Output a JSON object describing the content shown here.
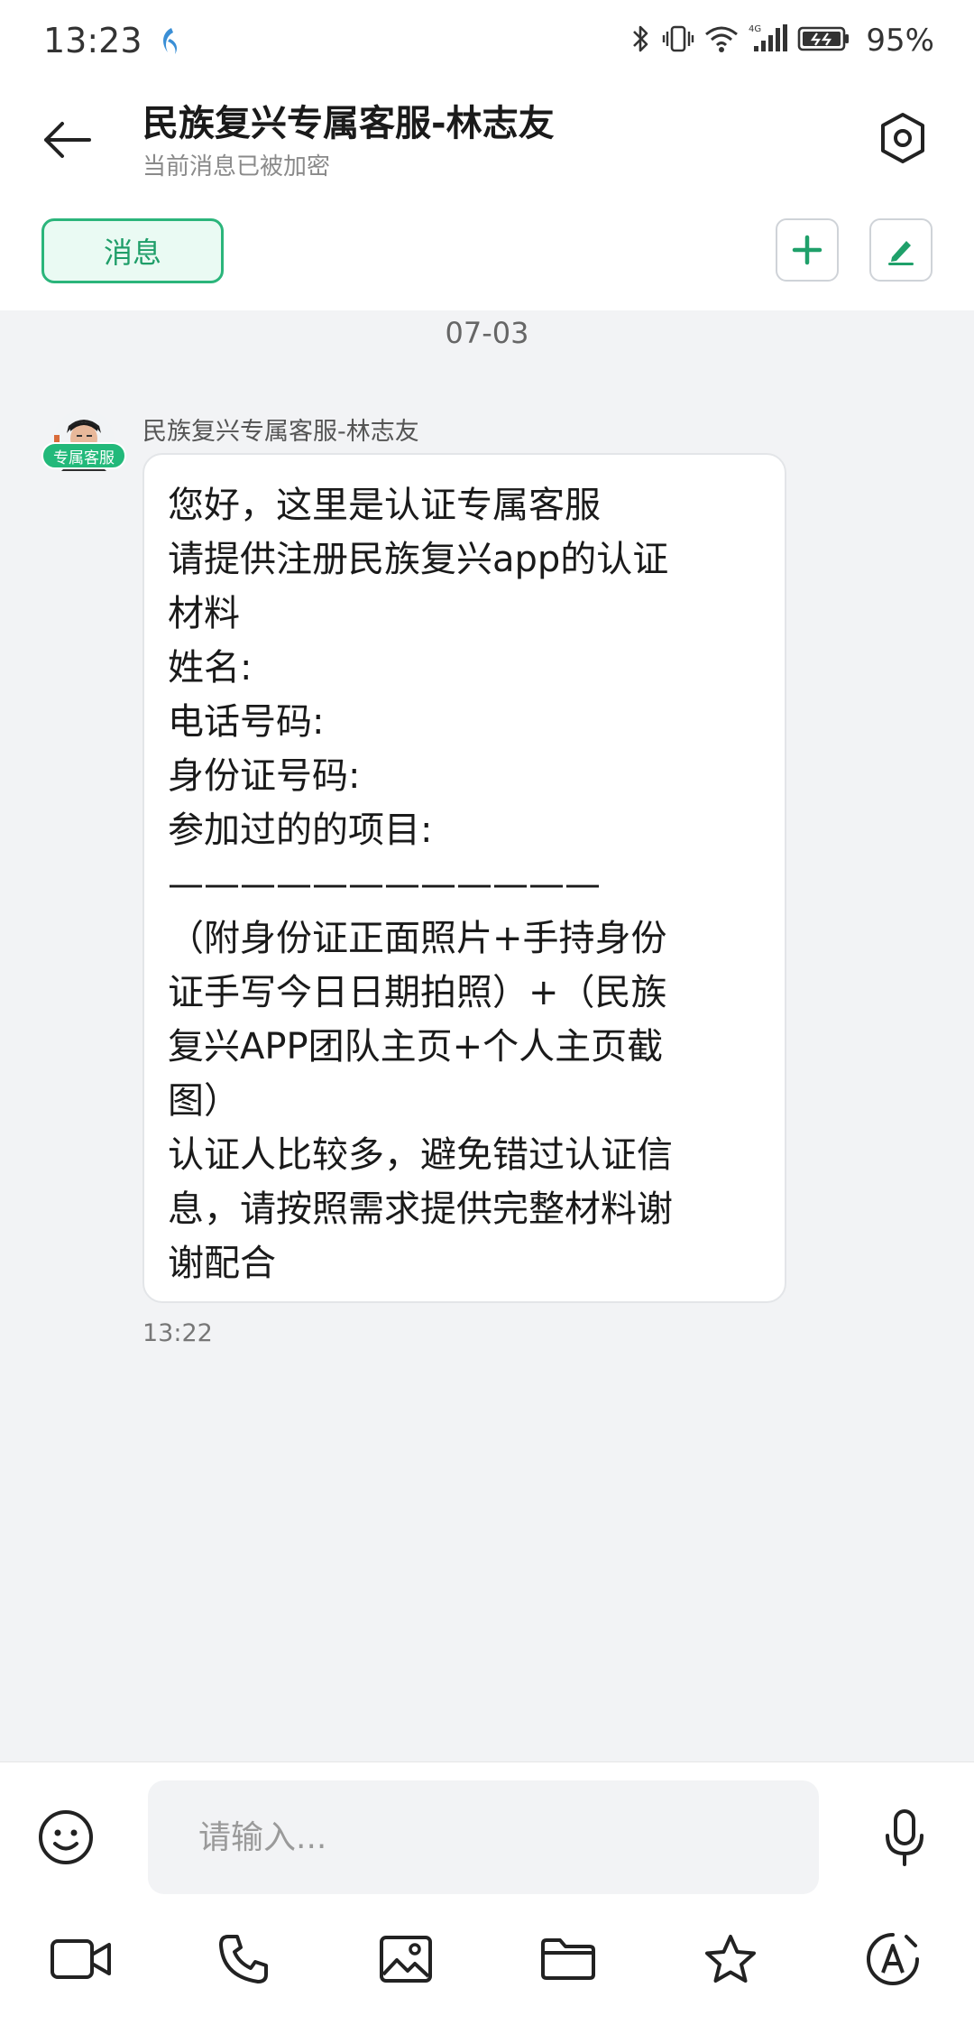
{
  "status_bar": {
    "time": "13:23",
    "battery": "95%",
    "icons": [
      "bluetooth-icon",
      "vibrate-icon",
      "wifi-icon",
      "cell-signal-4g-icon",
      "battery-icon"
    ]
  },
  "header": {
    "title": "民族复兴专属客服-林志友",
    "subtitle": "当前消息已被加密",
    "back_icon": "back-arrow-icon",
    "settings_icon": "settings-hexagon-icon"
  },
  "toolbar": {
    "tab_label": "消息",
    "add_icon": "plus-icon",
    "edit_icon": "edit-pen-icon"
  },
  "chat": {
    "date": "07-03",
    "messages": [
      {
        "sender": "民族复兴专属客服-林志友",
        "badge": "专属客服",
        "lines": [
          "您好，这里是认证专属客服",
          "请提供注册民族复兴app的认证",
          "材料",
          "姓名:",
          "电话号码:",
          "身份证号码:",
          "参加过的的项目:",
          "————————————",
          "（附身份证正面照片+手持身份",
          "证手写今日日期拍照）+（民族",
          "复兴APP团队主页+个人主页截",
          "图）",
          "认证人比较多，避免错过认证信",
          "息，请按照需求提供完整材料谢",
          "谢配合"
        ],
        "time": "13:22"
      }
    ]
  },
  "input": {
    "placeholder": "请输入...",
    "value": ""
  },
  "actions": [
    "video-call-icon",
    "phone-call-icon",
    "image-icon",
    "folder-icon",
    "star-icon",
    "font-style-icon"
  ],
  "colors": {
    "accent": "#2bb57b",
    "badge": "#22b97a",
    "background": "#f2f3f5"
  }
}
